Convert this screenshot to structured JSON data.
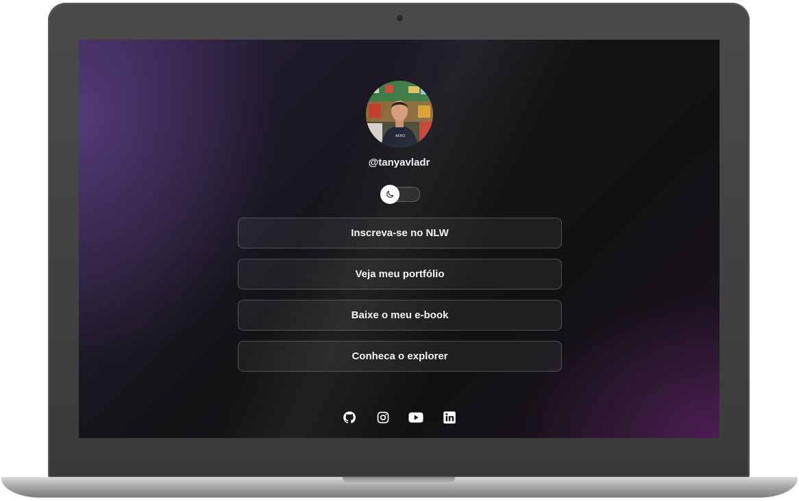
{
  "profile": {
    "username": "@tanyavladr",
    "avatar": "profile-photo"
  },
  "theme_toggle": {
    "icon": "moon-icon",
    "state": "dark"
  },
  "links": [
    {
      "label": "Inscreva-se no NLW"
    },
    {
      "label": "Veja meu portfólio"
    },
    {
      "label": "Baixe o meu e-book"
    },
    {
      "label": "Conheca o explorer"
    }
  ],
  "socials": [
    {
      "icon": "github-icon"
    },
    {
      "icon": "instagram-icon"
    },
    {
      "icon": "youtube-icon"
    },
    {
      "icon": "linkedin-icon"
    }
  ],
  "colors": {
    "text": "#f3f3f3",
    "button_border": "rgba(255,255,255,0.22)",
    "background_dark": "#111113",
    "accent_purple": "#6e2878"
  }
}
